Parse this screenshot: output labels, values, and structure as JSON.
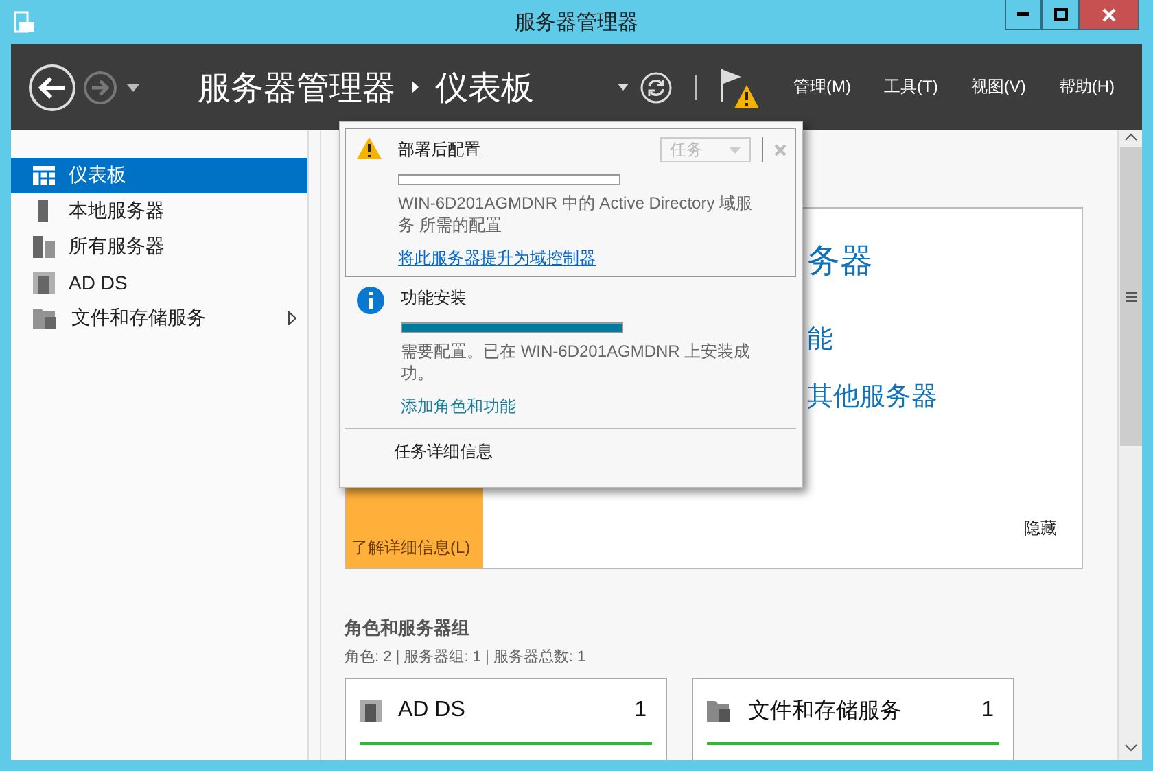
{
  "window": {
    "title": "服务器管理器"
  },
  "header": {
    "breadcrumb": [
      "服务器管理器",
      "仪表板"
    ],
    "menus": [
      "管理(M)",
      "工具(T)",
      "视图(V)",
      "帮助(H)"
    ]
  },
  "sidebar": {
    "items": [
      {
        "label": "仪表板",
        "kind": "dashboard",
        "selected": true,
        "expandable": false
      },
      {
        "label": "本地服务器",
        "kind": "server",
        "selected": false,
        "expandable": false
      },
      {
        "label": "所有服务器",
        "kind": "servers",
        "selected": false,
        "expandable": false
      },
      {
        "label": "AD DS",
        "kind": "adds",
        "selected": false,
        "expandable": false
      },
      {
        "label": "文件和存储服务",
        "kind": "files",
        "selected": false,
        "expandable": true
      }
    ]
  },
  "welcome": {
    "lines": [
      "务器",
      "能",
      "其他服务器"
    ],
    "learn_more": "了解详细信息(L)",
    "hide": "隐藏"
  },
  "roles": {
    "title": "角色和服务器组",
    "summary": "角色: 2 | 服务器组: 1 | 服务器总数: 1",
    "cards": [
      {
        "kind": "adds",
        "name": "AD DS",
        "count": "1"
      },
      {
        "kind": "files",
        "name": "文件和存储服务",
        "count": "1"
      }
    ]
  },
  "notifications": {
    "items": [
      {
        "kind": "warning",
        "title": "部署后配置",
        "level": 0,
        "message": "WIN-6D201AGMDNR 中的 Active Directory 域服务 所需的配置",
        "link": "将此服务器提升为域控制器",
        "selected": true,
        "task_button": "任务"
      },
      {
        "kind": "info",
        "title": "功能安装",
        "level": 1,
        "message": "需要配置。已在 WIN-6D201AGMDNR 上安装成功。",
        "link": "添加角色和功能",
        "selected": false
      }
    ],
    "footer": "任务详细信息"
  }
}
